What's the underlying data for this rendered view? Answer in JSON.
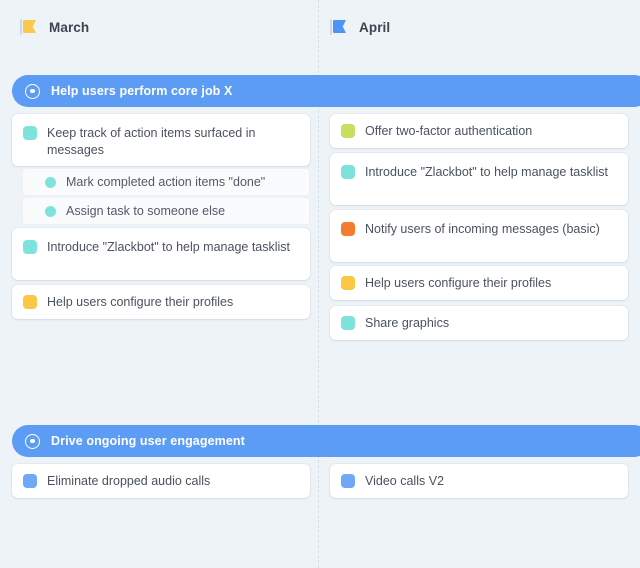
{
  "colors": {
    "background": "#eef3f7",
    "section_bar": "#5d9cf5",
    "divider": "#d6dee6",
    "teal": "#7fe3dd",
    "lime": "#c5e05f",
    "orange": "#f47c2e",
    "yellow": "#fbc846",
    "blue": "#6fa8f7",
    "flag_march": "#f8c94c",
    "flag_april": "#4d94f8"
  },
  "columns": [
    {
      "label": "March",
      "icon": "flag-icon",
      "flag_color": "#f8c94c"
    },
    {
      "label": "April",
      "icon": "flag-icon",
      "flag_color": "#4d94f8"
    }
  ],
  "sections": [
    {
      "title": "Help users perform core job X",
      "icon": "bullseye-icon",
      "march": [
        {
          "text": "Keep track of action items surfaced in messages",
          "color": "#7fe3dd",
          "subitems": [
            {
              "text": "Mark completed action items \"done\"",
              "color": "#7fe3dd"
            },
            {
              "text": "Assign task to someone else",
              "color": "#7fe3dd"
            }
          ]
        },
        {
          "text": "Introduce \"Zlackbot\" to help manage tasklist",
          "color": "#7fe3dd",
          "subitems": []
        },
        {
          "text": "Help users configure their profiles",
          "color": "#fbc846",
          "subitems": []
        }
      ],
      "april": [
        {
          "text": "Offer two-factor authentication",
          "color": "#c5e05f"
        },
        {
          "text": "Introduce \"Zlackbot\" to help manage tasklist",
          "color": "#7fe3dd"
        },
        {
          "text": "Notify users of incoming messages (basic)",
          "color": "#f47c2e"
        },
        {
          "text": "Help users configure their profiles",
          "color": "#fbc846"
        },
        {
          "text": "Share graphics",
          "color": "#7fe3dd"
        }
      ]
    },
    {
      "title": "Drive ongoing user engagement",
      "icon": "bullseye-icon",
      "march": [
        {
          "text": "Eliminate dropped audio calls",
          "color": "#6fa8f7",
          "subitems": []
        }
      ],
      "april": [
        {
          "text": "Video calls V2",
          "color": "#6fa8f7"
        }
      ]
    }
  ]
}
